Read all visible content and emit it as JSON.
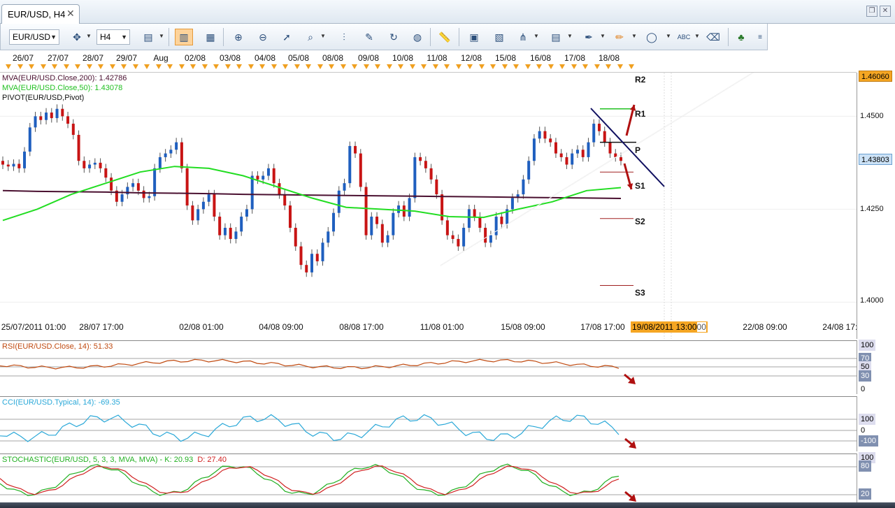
{
  "tab": {
    "title": "EUR/USD, H4",
    "close_glyph": "✕"
  },
  "window_buttons": [
    "❐",
    "✕"
  ],
  "toolbar": {
    "symbol_select": "EUR/USD",
    "timeframe_select": "H4",
    "icons": [
      "cursor-crosshair-icon",
      "bar-chart-icon",
      "candlestick-icon",
      "line-chart-icon",
      "zoom-in-icon",
      "zoom-out-icon",
      "pointer-icon",
      "magnifier-icon",
      "vertical-line-icon",
      "edit-icon",
      "rotate-icon",
      "globe-icon",
      "ruler-icon",
      "picture-icon",
      "chart-window-icon",
      "fork-icon",
      "indicator-icon",
      "pen-icon",
      "brush-icon",
      "ellipse-icon",
      "text-icon",
      "eraser-icon",
      "tree-icon",
      "more-icon"
    ]
  },
  "dates": [
    "26/07",
    "27/07",
    "28/07",
    "29/07",
    "Aug",
    "02/08",
    "03/08",
    "04/08",
    "05/08",
    "08/08",
    "09/08",
    "10/08",
    "11/08",
    "12/08",
    "15/08",
    "16/08",
    "17/08",
    "18/08"
  ],
  "main": {
    "legend": [
      {
        "text": "MVA(EUR/USD.Close,200): 1.42786",
        "color": "#4a1030"
      },
      {
        "text": "MVA(EUR/USD.Close,50): 1.43078",
        "color": "#22c022"
      },
      {
        "text": "PIVOT(EUR/USD,Pivot)",
        "color": "#111111"
      }
    ],
    "yticks": [
      "1.4500",
      "1.4250",
      "1.4000"
    ],
    "price_top": "1.46060",
    "price_current": "1.43803",
    "levels": {
      "r2": "R2",
      "r1": "R1",
      "p": "P",
      "s1": "S1",
      "s2": "S2",
      "s3": "S3"
    },
    "xlabels": [
      "25/07/2011 01:00",
      "28/07 17:00",
      "02/08 01:00",
      "04/08 09:00",
      "08/08 17:00",
      "11/08 01:00",
      "15/08 09:00",
      "17/08 17:00",
      "22/08 09:00",
      "24/08 17:00"
    ],
    "cursor_time": "19/08/2011 13:00",
    "cursor_time_suffix": "00"
  },
  "rsi": {
    "legend": "RSI(EUR/USD.Close, 14): 51.33",
    "color": "#c04a10",
    "ticks": [
      "100",
      "70",
      "50",
      "30",
      "0"
    ]
  },
  "cci": {
    "legend": "CCI(EUR/USD.Typical, 14): -69.35",
    "color": "#2aa8d8",
    "ticks": [
      "100",
      "0",
      "-100"
    ]
  },
  "stoch": {
    "legend_a": "STOCHASTIC(EUR/USD, 5, 3, 3, MVA, MVA)  -  K: 20.93",
    "legend_b": "D: 27.40",
    "color_a": "#22b022",
    "color_b": "#d02020",
    "ticks": [
      "100",
      "80",
      "20"
    ]
  },
  "chart_data": {
    "type": "candlestick",
    "symbol": "EUR/USD",
    "timeframe": "H4",
    "ylim": [
      1.395,
      1.4606
    ],
    "candles_close_estimate": [
      1.437,
      1.4365,
      1.4372,
      1.436,
      1.4405,
      1.447,
      1.45,
      1.449,
      1.451,
      1.4495,
      1.452,
      1.45,
      1.448,
      1.445,
      1.438,
      1.436,
      1.437,
      1.4375,
      1.436,
      1.4335,
      1.43,
      1.427,
      1.429,
      1.431,
      1.432,
      1.43,
      1.428,
      1.4285,
      1.436,
      1.439,
      1.44,
      1.441,
      1.443,
      1.436,
      1.426,
      1.422,
      1.425,
      1.427,
      1.429,
      1.423,
      1.418,
      1.42,
      1.417,
      1.419,
      1.423,
      1.425,
      1.434,
      1.433,
      1.434,
      1.436,
      1.432,
      1.429,
      1.426,
      1.42,
      1.415,
      1.41,
      1.408,
      1.413,
      1.411,
      1.416,
      1.419,
      1.424,
      1.43,
      1.432,
      1.442,
      1.44,
      1.431,
      1.418,
      1.423,
      1.421,
      1.416,
      1.418,
      1.424,
      1.426,
      1.423,
      1.428,
      1.439,
      1.438,
      1.436,
      1.433,
      1.429,
      1.422,
      1.418,
      1.417,
      1.415,
      1.42,
      1.425,
      1.423,
      1.42,
      1.416,
      1.418,
      1.423,
      1.421,
      1.425,
      1.428,
      1.429,
      1.433,
      1.438,
      1.444,
      1.446,
      1.444,
      1.443,
      1.44,
      1.439,
      1.437,
      1.44,
      1.441,
      1.439,
      1.443,
      1.448,
      1.446,
      1.443,
      1.44,
      1.439,
      1.438
    ],
    "sma200_estimate": [
      1.43,
      1.4298,
      1.4297,
      1.4296,
      1.4294,
      1.4293,
      1.4292,
      1.429,
      1.4289,
      1.4288,
      1.4287,
      1.4286,
      1.4285,
      1.4284,
      1.4283,
      1.4282,
      1.4281,
      1.428,
      1.4279
    ],
    "sma50_estimate": [
      1.422,
      1.425,
      1.429,
      1.432,
      1.435,
      1.4365,
      1.436,
      1.434,
      1.431,
      1.428,
      1.4255,
      1.425,
      1.4245,
      1.423,
      1.4228,
      1.425,
      1.427,
      1.43,
      1.4308
    ],
    "pivots": {
      "R2": 1.459,
      "R1": 1.452,
      "P": 1.443,
      "S1": 1.435,
      "S2": 1.4225,
      "S3": 1.4045
    }
  }
}
